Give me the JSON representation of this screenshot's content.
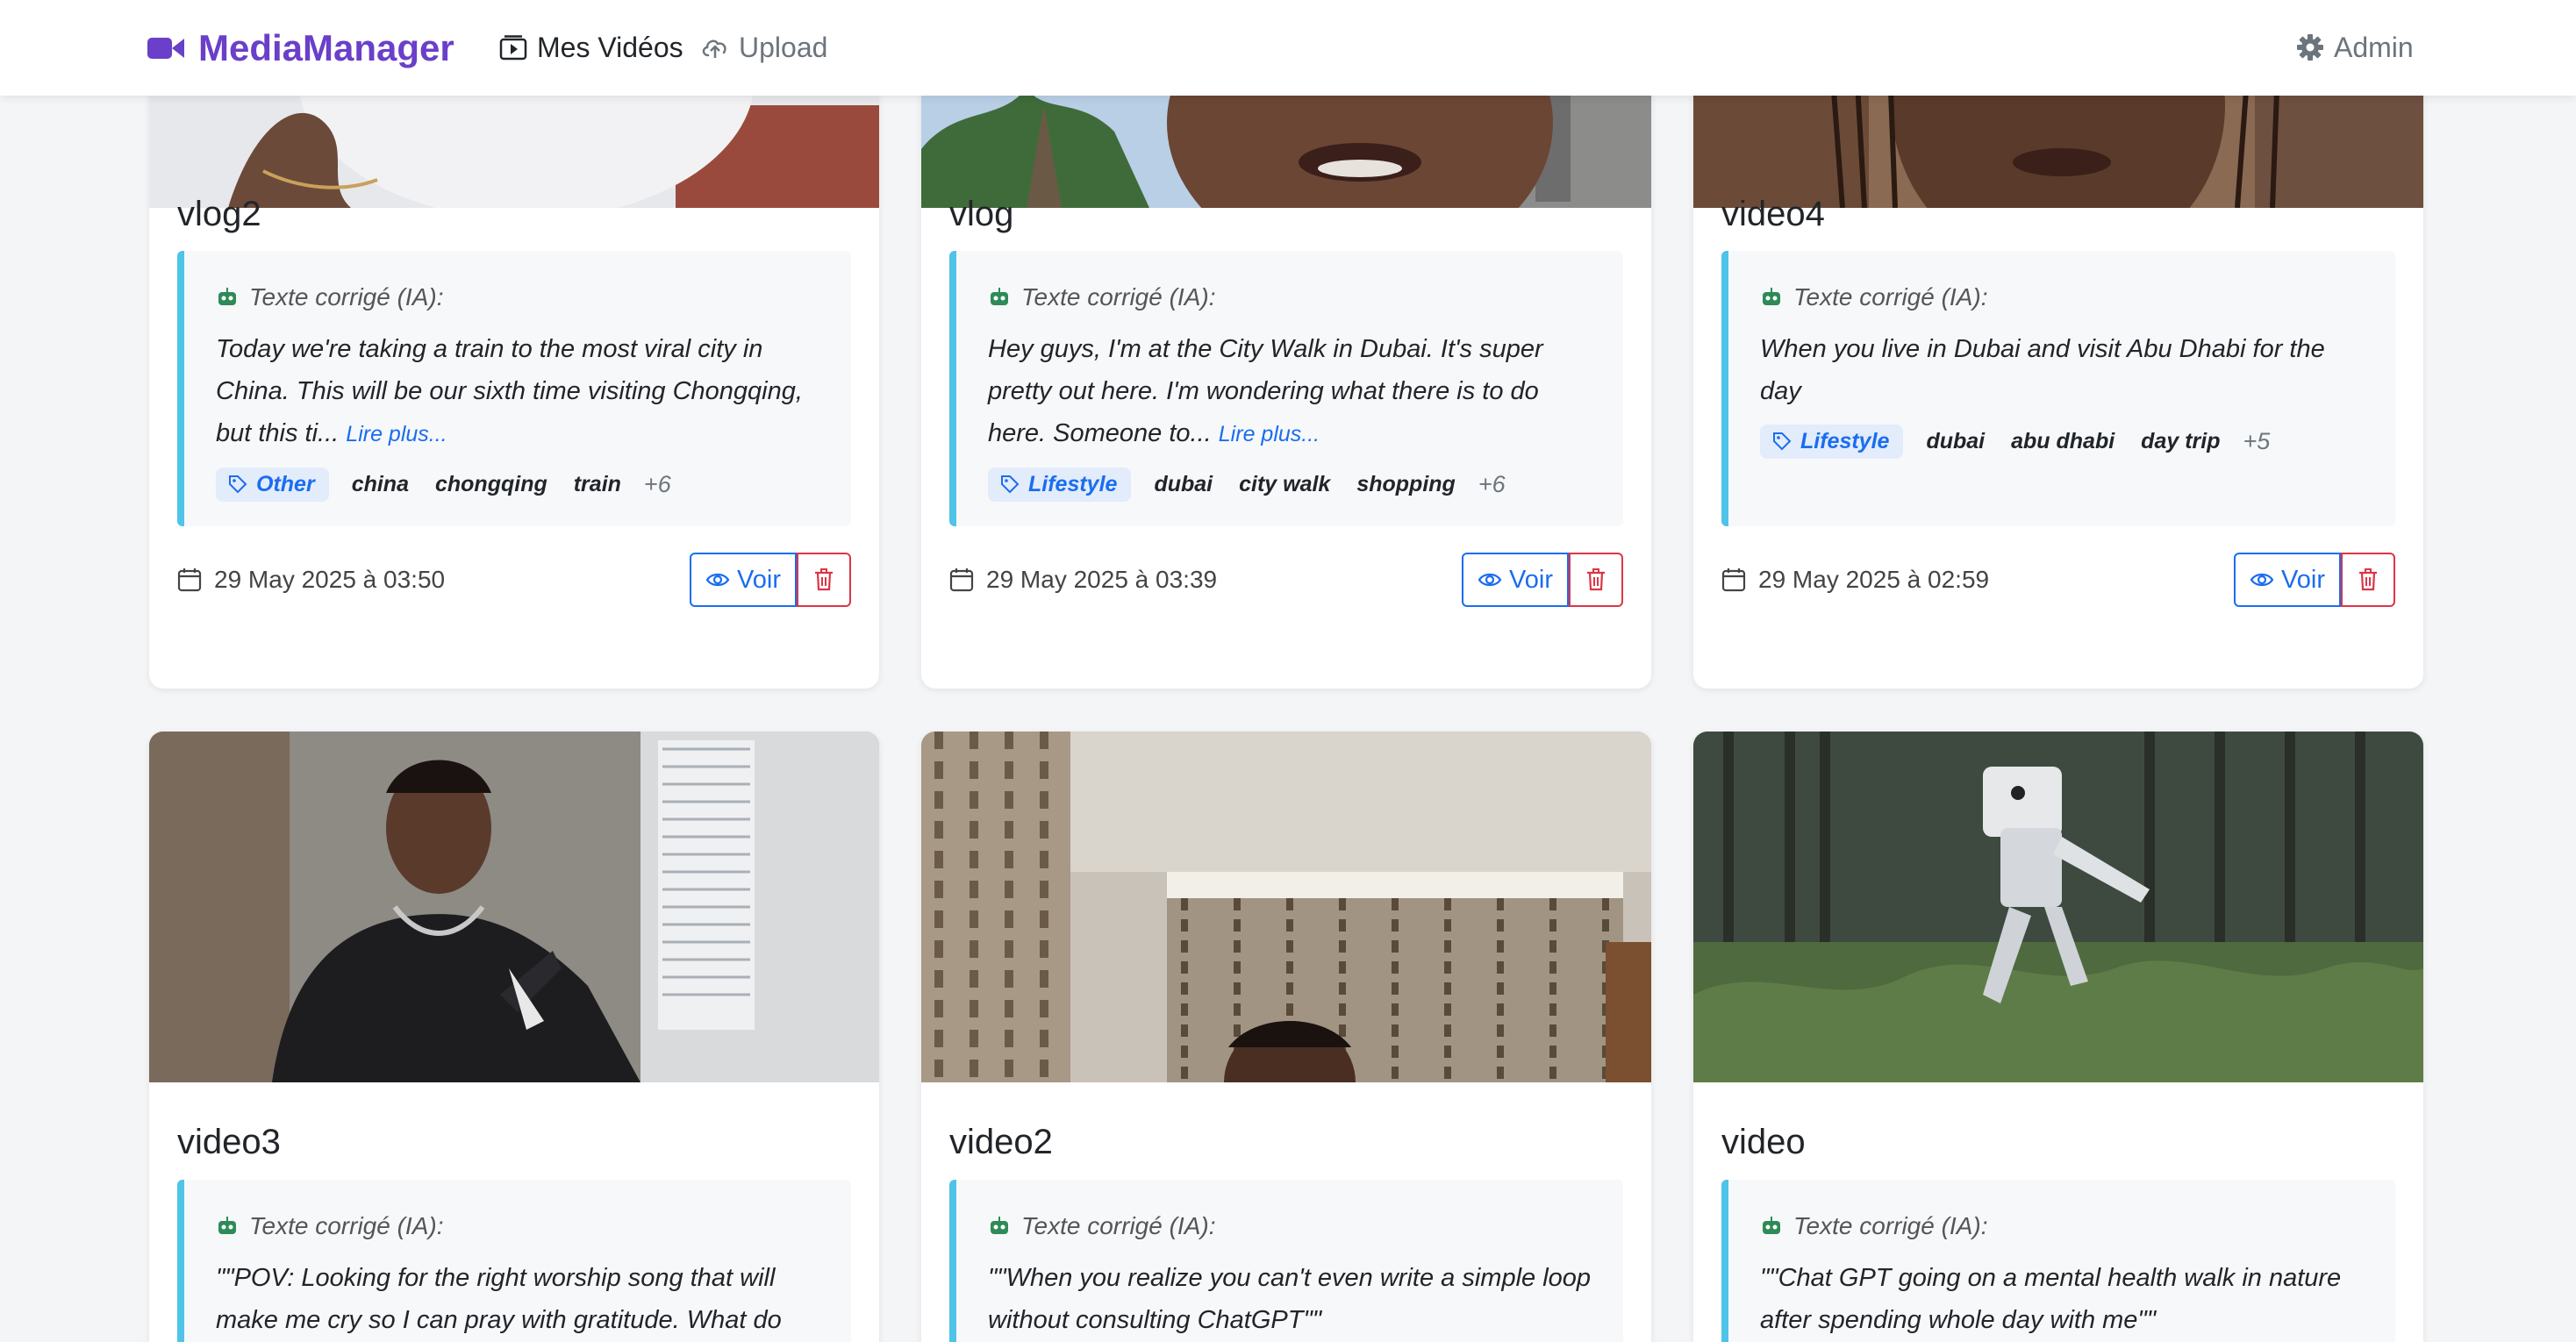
{
  "navbar": {
    "brand": "MediaManager",
    "links": {
      "videos": "Mes Vidéos",
      "upload": "Upload",
      "admin": "Admin"
    }
  },
  "labels": {
    "ai_header": "Texte corrigé (IA):",
    "read_more": "Lire plus...",
    "view_button": "Voir"
  },
  "videos": [
    {
      "title": "vlog2",
      "ai_text": "Today we're taking a train to the most viral city in China. This will be our sixth time visiting Chongqing, but this ti...",
      "category": "Other",
      "tags": [
        "china",
        "chongqing",
        "train"
      ],
      "more_tags": "+6",
      "date": "29 May 2025 à 03:50"
    },
    {
      "title": "vlog",
      "ai_text": "Hey guys, I'm at the City Walk in Dubai. It's super pretty out here. I'm wondering what there is to do here. Someone to...",
      "category": "Lifestyle",
      "tags": [
        "dubai",
        "city walk",
        "shopping"
      ],
      "more_tags": "+6",
      "date": "29 May 2025 à 03:39"
    },
    {
      "title": "video4",
      "ai_text": "When you live in Dubai and visit Abu Dhabi for the day",
      "category": "Lifestyle",
      "tags": [
        "dubai",
        "abu dhabi",
        "day trip"
      ],
      "more_tags": "+5",
      "date": "29 May 2025 à 02:59"
    },
    {
      "title": "video3",
      "ai_text": "\"\"POV: Looking for the right worship song that will make me cry so I can pray with gratitude. What do"
    },
    {
      "title": "video2",
      "ai_text": "\"\"When you realize you can't even write a simple loop without consulting ChatGPT\"\""
    },
    {
      "title": "video",
      "ai_text": "\"\"Chat GPT going on a mental health walk in nature after spending whole day with me\"\""
    }
  ]
}
